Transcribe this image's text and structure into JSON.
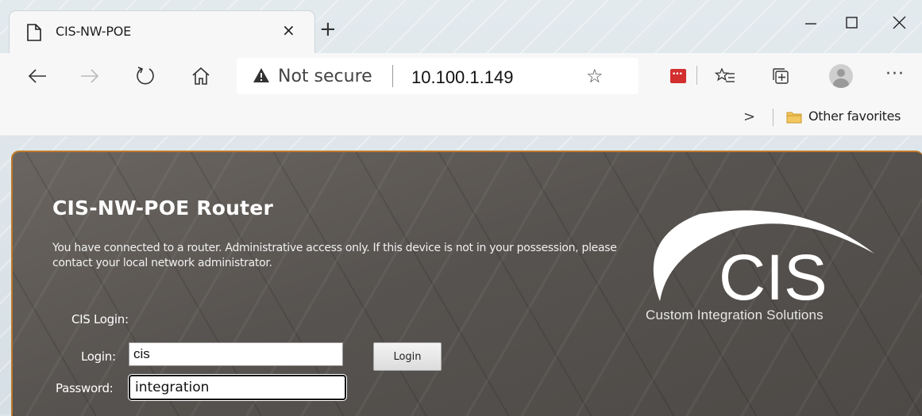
{
  "browser": {
    "tab": {
      "title": "CIS-NW-POE",
      "close_glyph": "×",
      "icon": "page-icon"
    },
    "new_tab_glyph": "+",
    "window_controls": [
      "minimize",
      "maximize",
      "close"
    ],
    "address_bar": {
      "security_label": "Not secure",
      "url": "10.100.1.149"
    },
    "favorites_bar": {
      "chevron": ">",
      "folder_label": "Other favorites"
    },
    "colors": {
      "toolbar_bg": "#f7f7f7",
      "extension_red": "#d32f2f"
    }
  },
  "page": {
    "title": "CIS-NW-POE Router",
    "intro": "You have connected to a router. Administrative access only. If this device is not in your possession, please contact your local network administrator.",
    "login_section_label": "CIS Login:",
    "login_label": "Login:",
    "password_label": "Password:",
    "login_value": "cis",
    "password_value": "integration",
    "login_button": "Login",
    "logo": {
      "letters": "CIS",
      "tagline": "Custom Integration Solutions"
    },
    "colors": {
      "border_accent": "#c07a2a",
      "panel_bg": "#575350"
    }
  }
}
